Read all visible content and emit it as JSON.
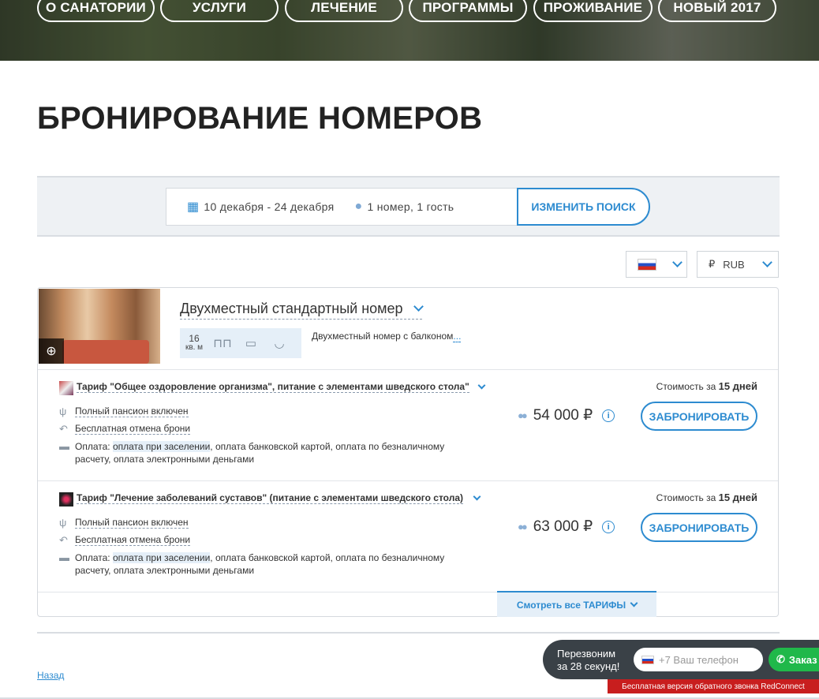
{
  "nav": {
    "items": [
      "О САНАТОРИИ",
      "УСЛУГИ",
      "ЛЕЧЕНИЕ",
      "ПРОГРАММЫ",
      "ПРОЖИВАНИЕ",
      "НОВЫЙ 2017"
    ]
  },
  "page_title": "БРОНИРОВАНИЕ НОМЕРОВ",
  "search": {
    "dates": "10 декабря - 24 декабря",
    "guests": "1 номер, 1 гость",
    "button": "ИЗМЕНИТЬ ПОИСК"
  },
  "currency": {
    "symbol": "₽",
    "code": "RUB"
  },
  "room": {
    "title": "Двухместный стандартный номер",
    "area_value": "16",
    "area_unit": "кв. м",
    "description": "Двухместный номер с балконом",
    "more": "..."
  },
  "tariffs": [
    {
      "name": "Тариф \"Общее оздоровление организма\", питание с элементами шведского стола\"",
      "meal": "Полный пансион включен",
      "cancel": "Бесплатная отмена брони",
      "pay_prefix": "Оплата: ",
      "pay_highlight": "оплата при заселении",
      "pay_rest": ", оплата банковской картой, оплата по безналичному",
      "pay_line2": "расчету, оплата электронными деньгами",
      "cost_label": "Стоимость за",
      "cost_days": "15 дней",
      "price": "54 000 ₽",
      "book": "ЗАБРОНИРОВАТЬ"
    },
    {
      "name": "Тариф \"Лечение заболеваний суставов\" (питание с элементами шведского стола)",
      "meal": "Полный пансион включен",
      "cancel": "Бесплатная отмена брони",
      "pay_prefix": "Оплата: ",
      "pay_highlight": "оплата при заселении",
      "pay_rest": ", оплата банковской картой, оплата по безналичному",
      "pay_line2": "расчету, оплата электронными деньгами",
      "cost_label": "Стоимость за",
      "cost_days": "15 дней",
      "price": "63 000 ₽",
      "book": "ЗАБРОНИРОВАТЬ"
    }
  ],
  "see_all": "Смотреть все ТАРИФЫ",
  "back": "Назад",
  "callback": {
    "line1": "Перезвоним",
    "line2": "за 28 секунд!",
    "placeholder": "+7 Ваш телефон",
    "button": "Заказ",
    "banner": "Бесплатная версия обратного звонка RedConnect"
  },
  "colors": {
    "accent": "#2d8bd0",
    "callback_bg": "#3a4147",
    "callback_btn": "#20b84a",
    "banner": "#c81e1e"
  }
}
